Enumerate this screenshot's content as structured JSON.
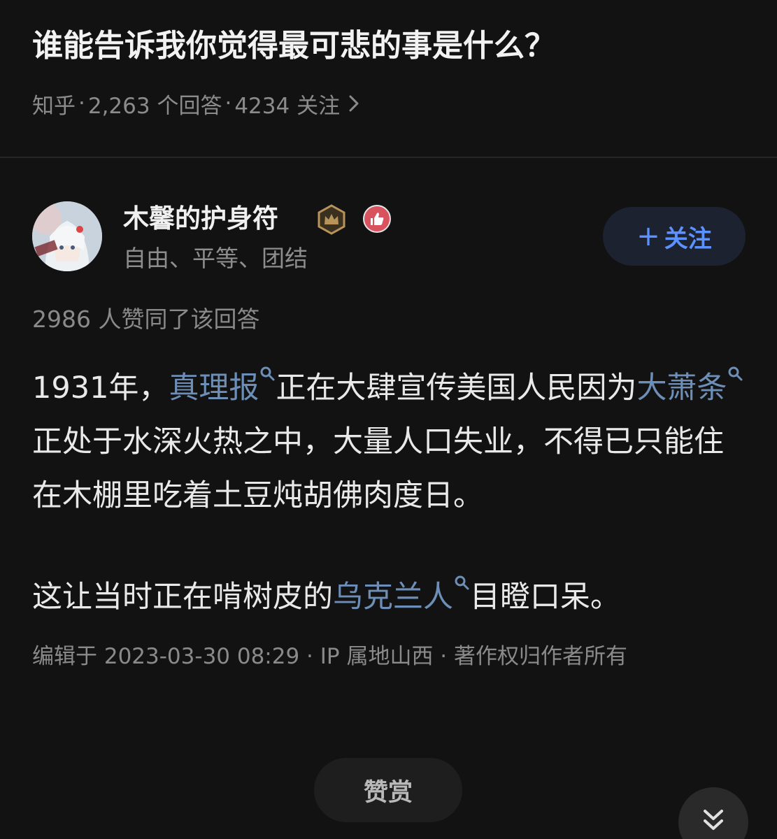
{
  "question": {
    "title": "谁能告诉我你觉得最可悲的事是什么？",
    "source": "知乎",
    "answers": "2,263 个回答",
    "followers": "4234 关注"
  },
  "author": {
    "name": "木馨的护身符",
    "bio": "自由、平等、团结",
    "follow_label": "关注",
    "badges": [
      "crown-badge-icon",
      "thumbs-up-badge-icon"
    ]
  },
  "votes": "2986 人赞同了该回答",
  "body": {
    "p1": {
      "t1": "1931年，",
      "link1": "真理报",
      "t2": "正在大肆宣传美国人民因为",
      "link2": "大萧条",
      "t3": "正处于水深火热之中，大量人口失业，不得已只能住在木棚里吃着土豆炖胡佛肉度日。"
    },
    "p2": {
      "t1": "这让当时正在啃树皮的",
      "link1": "乌克兰人",
      "t2": "目瞪口呆。"
    }
  },
  "edit_info": "编辑于 2023-03-30 08:29 · IP 属地山西 · 著作权归作者所有",
  "reward_label": "赞赏",
  "colors": {
    "background": "#121212",
    "link": "#6d8fb7",
    "follow_text": "#5c92ff",
    "crown_gold": "#b8935a",
    "like_red": "#d9535f"
  }
}
